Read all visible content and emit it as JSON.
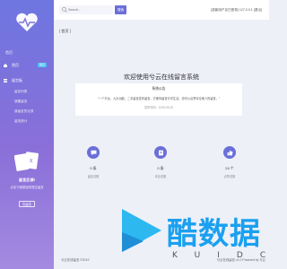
{
  "sidebar": {
    "brand": "首页",
    "nav": [
      {
        "label": "首页",
        "badge": "首页"
      },
      {
        "label": "留言板"
      }
    ],
    "sub_items": [
      "留言列表",
      "我要留言",
      "我留言的记录",
      "留言统计"
    ],
    "promo": {
      "title": "留言反馈!",
      "subtitle": "点击下面按钮来提交留言",
      "button": "去留言"
    }
  },
  "topbar": {
    "search_placeholder": "Search...",
    "search_button": "搜索",
    "user_info": "[游客用户名已登录] 127.0.0.1 [退出]"
  },
  "main": {
    "breadcrumb": "| 首页 |",
    "welcome": "欢迎使用兮云在线留言系统",
    "notice": {
      "title": "系统公告",
      "text": "“一个平台，九大功能，二手留言发布留言，方便你留言分享生活，也可以点赞评论他人的留言。”",
      "date": "发布时间：2019-09-20"
    },
    "stats": [
      {
        "value": "0 条",
        "label": "留言总数",
        "icon": "chat-icon"
      },
      {
        "value": "0 条",
        "label": "评论总数",
        "icon": "comment-icon"
      },
      {
        "value": "24 个",
        "label": "点赞总数",
        "icon": "thumbs-up-icon"
      }
    ]
  },
  "footer": {
    "left": "兮云在线留言 ©2019",
    "right": "兮云在线留言 v1.0 Powered by 兮云"
  },
  "watermark": {
    "text": "酷数据",
    "sub": "KUIDC"
  }
}
